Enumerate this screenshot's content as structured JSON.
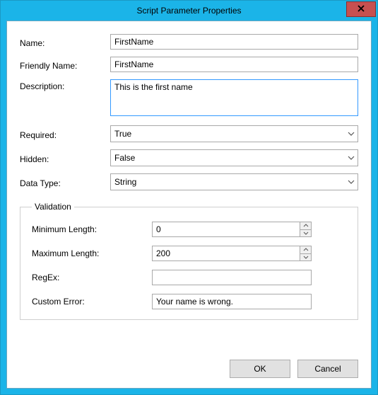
{
  "window": {
    "title": "Script Parameter Properties"
  },
  "labels": {
    "name": "Name:",
    "friendly": "Friendly Name:",
    "description": "Description:",
    "required": "Required:",
    "hidden": "Hidden:",
    "dataType": "Data Type:"
  },
  "fields": {
    "name": "FirstName",
    "friendly": "FirstName",
    "description": "This is the first name",
    "required": "True",
    "hidden": "False",
    "dataType": "String"
  },
  "validation": {
    "legend": "Validation",
    "minLabel": "Minimum Length:",
    "maxLabel": "Maximum Length:",
    "regexLabel": "RegEx:",
    "errorLabel": "Custom Error:",
    "min": "0",
    "max": "200",
    "regex": "",
    "error": "Your name is wrong."
  },
  "buttons": {
    "ok": "OK",
    "cancel": "Cancel"
  }
}
